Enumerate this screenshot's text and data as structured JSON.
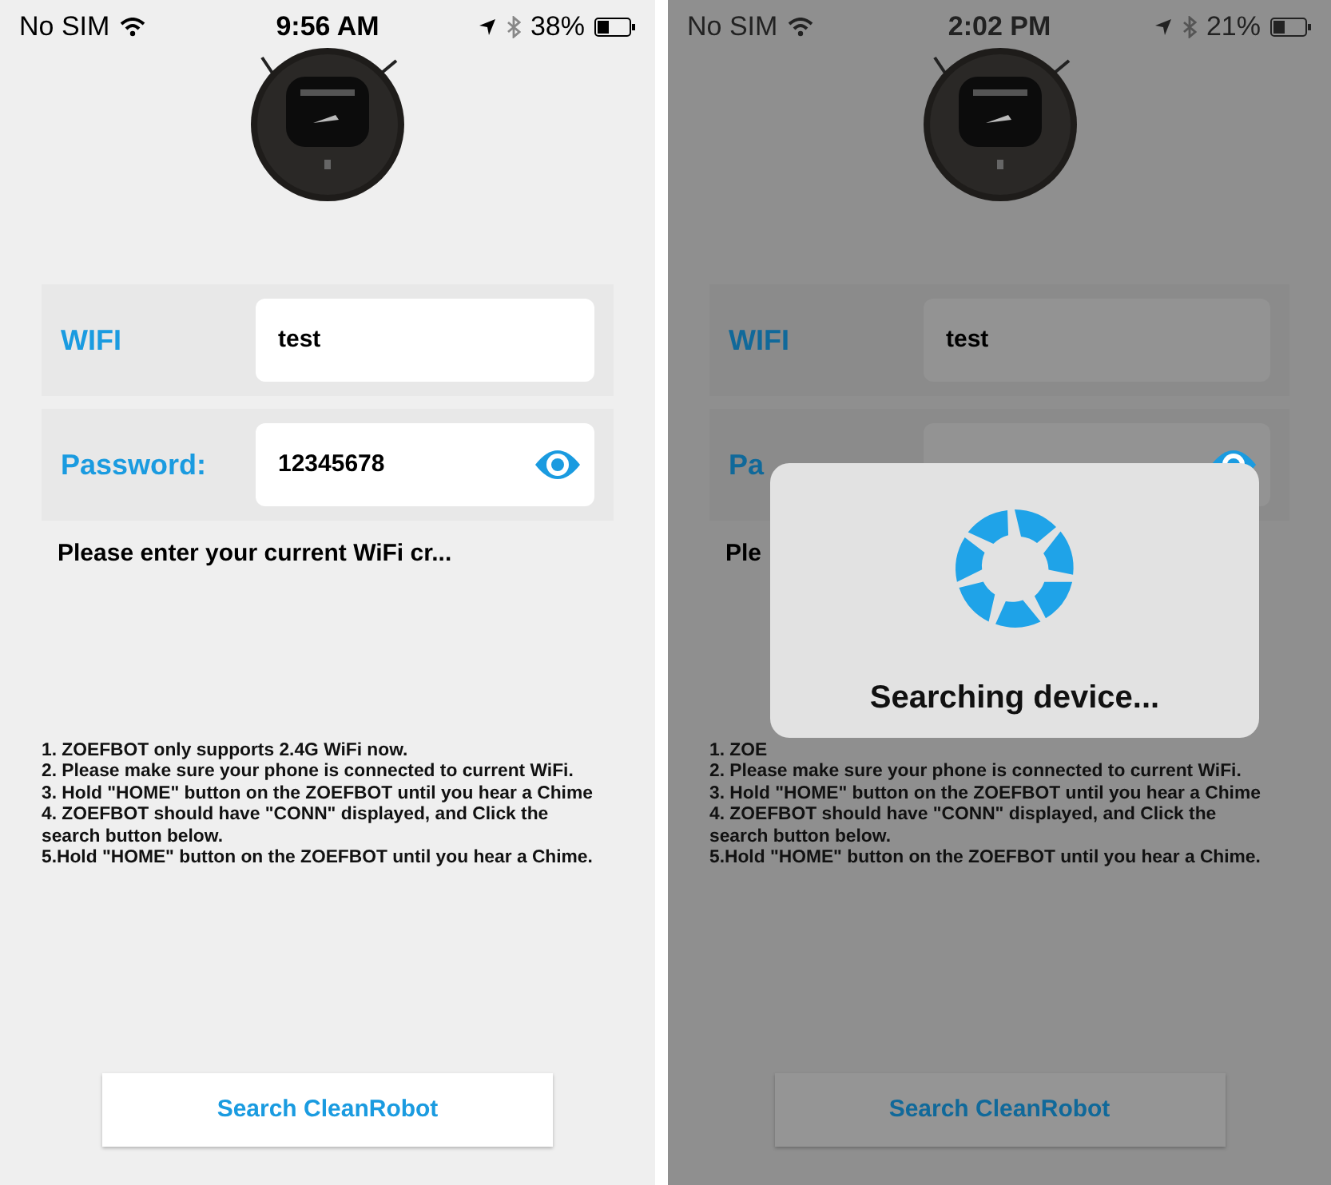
{
  "screens": [
    {
      "dimmed": false,
      "status_bar": {
        "carrier": "No SIM",
        "time": "9:56 AM",
        "battery": "38%"
      },
      "wifi": {
        "label": "WIFI",
        "value": "test"
      },
      "password": {
        "label": "Password:",
        "value": "12345678"
      },
      "hint": "Please enter your current WiFi cr...",
      "instructions": [
        "1. ZOEFBOT only supports 2.4G WiFi now.",
        "2. Please make sure your phone is connected to current WiFi.",
        "3. Hold \"HOME\" button on the ZOEFBOT until you hear a Chime",
        "4. ZOEFBOT should have \"CONN\" displayed, and Click the search button below.",
        "5.Hold \"HOME\" button on the ZOEFBOT until you hear a Chime."
      ],
      "button": "Search CleanRobot"
    },
    {
      "dimmed": true,
      "status_bar": {
        "carrier": "No SIM",
        "time": "2:02 PM",
        "battery": "21%"
      },
      "wifi": {
        "label": "WIFI",
        "value": "test"
      },
      "password": {
        "label": "Pa"
      },
      "hint": "Ple",
      "instructions": [
        "1. ZOE",
        "2. Please make sure your phone is connected to current WiFi.",
        "3. Hold \"HOME\" button on the ZOEFBOT until you hear a Chime",
        "4. ZOEFBOT should have \"CONN\" displayed, and Click the search button below.",
        "5.Hold \"HOME\" button on the ZOEFBOT until you hear a Chime."
      ],
      "button": "Search CleanRobot",
      "dialog": {
        "message": "Searching device..."
      }
    }
  ]
}
